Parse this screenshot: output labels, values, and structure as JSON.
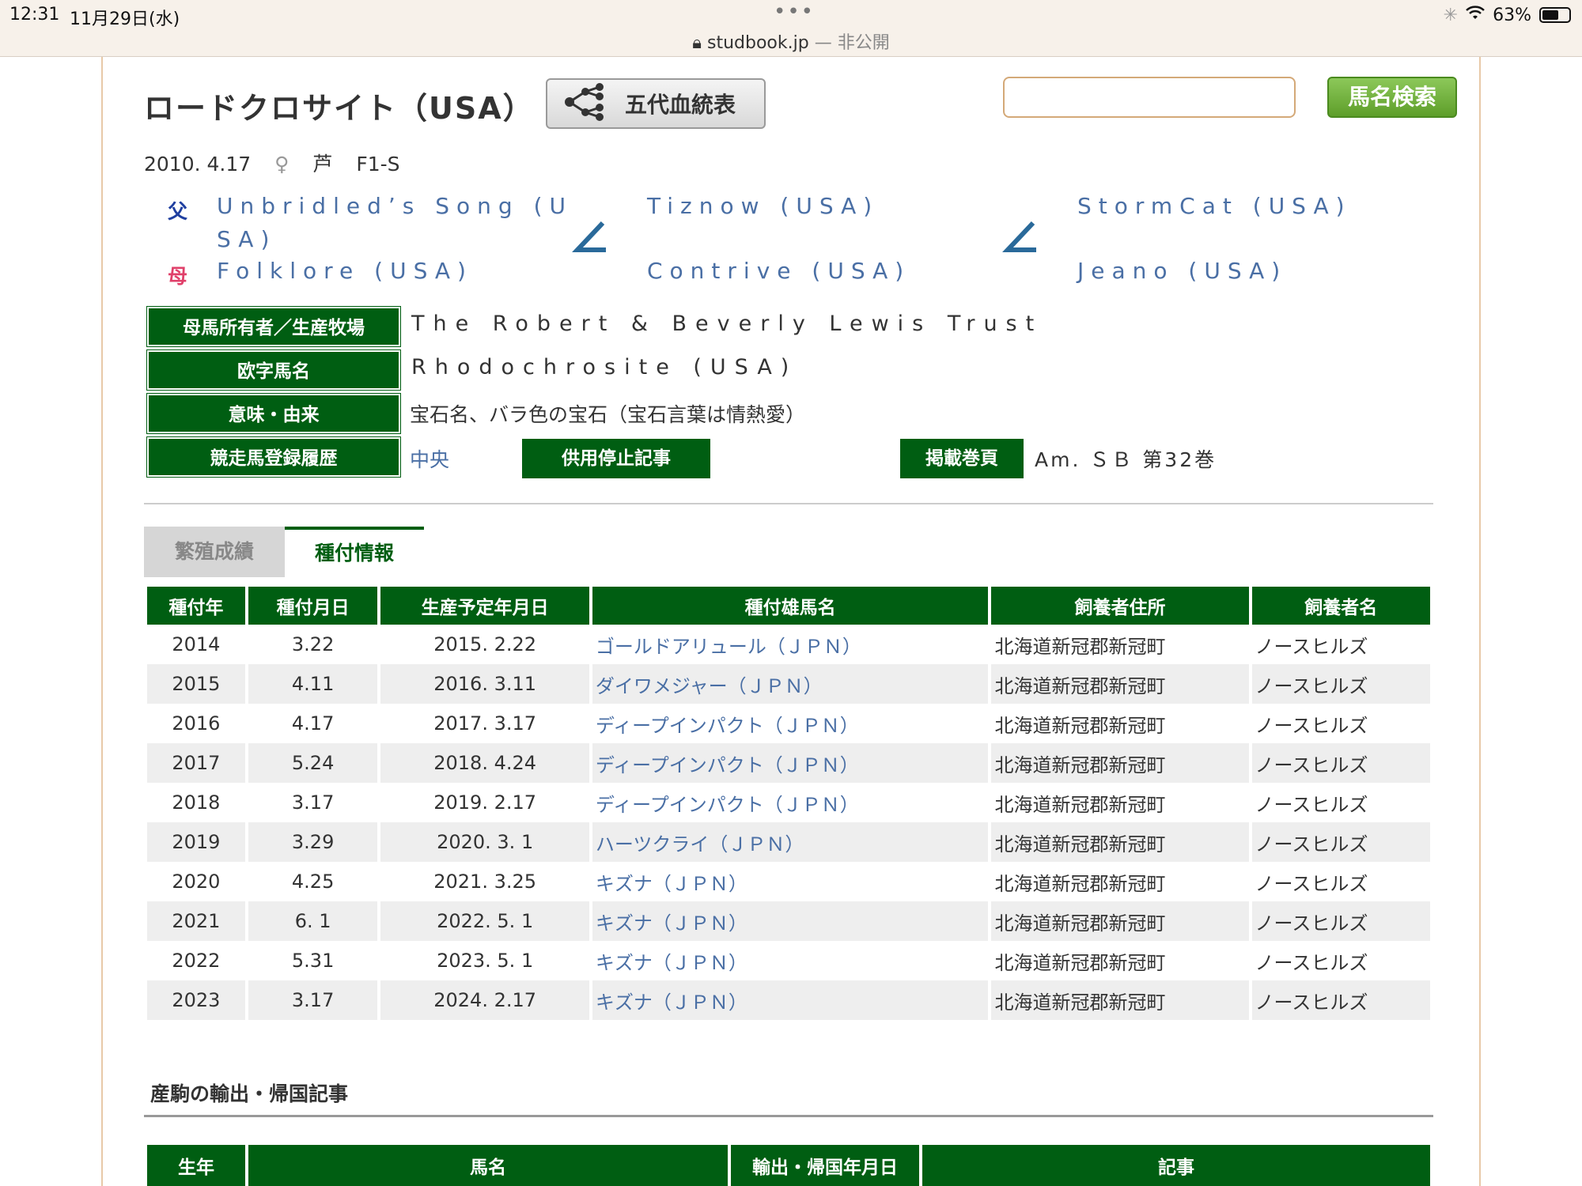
{
  "status_bar": {
    "time": "12:31",
    "date": "11月29日(水)",
    "dots": "•••",
    "url": "studbook.jp",
    "url_privacy": "— 非公開",
    "battery": "63%",
    "battery_level": 0.63
  },
  "horse": {
    "name": "ロードクロサイト（USA）",
    "pedigree_button": "五代血統表",
    "birth_date": "2010. 4.17",
    "sex_symbol": "♀",
    "color": "芦",
    "grade": "F1-S"
  },
  "search": {
    "placeholder": "",
    "button": "馬名検索"
  },
  "pedigree": {
    "sire_label": "父",
    "dam_label": "母",
    "sire_line1": "Unbridled’s Song (U",
    "sire_line2": "SA)",
    "dam": "Folklore (USA)",
    "sire_sire": "Tiznow (USA)",
    "sire_dam": "Contrive (USA)",
    "dam_sire": "StormCat (USA)",
    "dam_dam": "Jeano (USA)"
  },
  "info": {
    "owner_label": "母馬所有者／生産牧場",
    "owner_value": "The Robert & Beverly Lewis Trust",
    "roman_label": "欧字馬名",
    "roman_value": "Rhodochrosite (USA)",
    "meaning_label": "意味・由来",
    "meaning_value": "宝石名、バラ色の宝石（宝石言葉は情熱愛）",
    "history_label": "競走馬登録履歴",
    "history_value": "中央",
    "retire_button": "供用停止記事",
    "volume_label": "掲載巻頁",
    "volume_value": "Am. ＳＢ 第32巻"
  },
  "tabs": {
    "breeding_record": "繁殖成績",
    "mating_info": "種付情報"
  },
  "mating_table": {
    "headers": [
      "種付年",
      "種付月日",
      "生産予定年月日",
      "種付雄馬名",
      "飼養者住所",
      "飼養者名"
    ],
    "rows": [
      [
        "2014",
        "3.22",
        "2015. 2.22",
        "ゴールドアリュール（ＪＰＮ）",
        "北海道新冠郡新冠町",
        "ノースヒルズ"
      ],
      [
        "2015",
        "4.11",
        "2016. 3.11",
        "ダイワメジャー（ＪＰＮ）",
        "北海道新冠郡新冠町",
        "ノースヒルズ"
      ],
      [
        "2016",
        "4.17",
        "2017. 3.17",
        "ディープインパクト（ＪＰＮ）",
        "北海道新冠郡新冠町",
        "ノースヒルズ"
      ],
      [
        "2017",
        "5.24",
        "2018. 4.24",
        "ディープインパクト（ＪＰＮ）",
        "北海道新冠郡新冠町",
        "ノースヒルズ"
      ],
      [
        "2018",
        "3.17",
        "2019. 2.17",
        "ディープインパクト（ＪＰＮ）",
        "北海道新冠郡新冠町",
        "ノースヒルズ"
      ],
      [
        "2019",
        "3.29",
        "2020. 3. 1",
        "ハーツクライ（ＪＰＮ）",
        "北海道新冠郡新冠町",
        "ノースヒルズ"
      ],
      [
        "2020",
        "4.25",
        "2021. 3.25",
        "キズナ（ＪＰＮ）",
        "北海道新冠郡新冠町",
        "ノースヒルズ"
      ],
      [
        "2021",
        "6. 1",
        "2022. 5. 1",
        "キズナ（ＪＰＮ）",
        "北海道新冠郡新冠町",
        "ノースヒルズ"
      ],
      [
        "2022",
        "5.31",
        "2023. 5. 1",
        "キズナ（ＪＰＮ）",
        "北海道新冠郡新冠町",
        "ノースヒルズ"
      ],
      [
        "2023",
        "3.17",
        "2024. 2.17",
        "キズナ（ＪＰＮ）",
        "北海道新冠郡新冠町",
        "ノースヒルズ"
      ]
    ]
  },
  "export_section": {
    "title": "産駒の輸出・帰国記事",
    "headers": [
      "生年",
      "馬名",
      "輸出・帰国年月日",
      "記事"
    ]
  },
  "colors": {
    "header_green": "#005e12",
    "link_blue": "#4a6fa5",
    "sire_blue": "#1f3fa0",
    "dam_red": "#e0406a"
  }
}
